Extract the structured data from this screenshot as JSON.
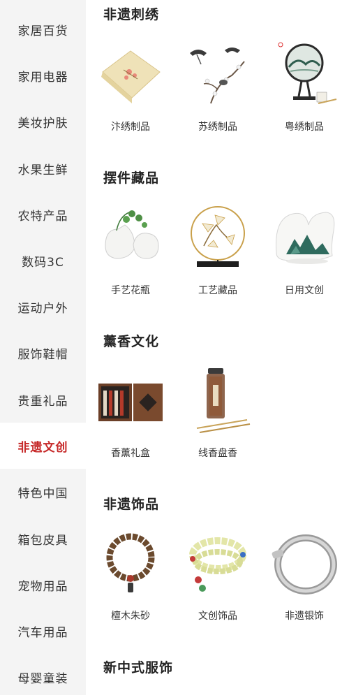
{
  "sidebar": {
    "items": [
      {
        "label": "家居百货"
      },
      {
        "label": "家用电器"
      },
      {
        "label": "美妆护肤"
      },
      {
        "label": "水果生鲜"
      },
      {
        "label": "农特产品"
      },
      {
        "label": "数码3C"
      },
      {
        "label": "运动户外"
      },
      {
        "label": "服饰鞋帽"
      },
      {
        "label": "贵重礼品"
      },
      {
        "label": "非遗文创",
        "active": true
      },
      {
        "label": "特色中国"
      },
      {
        "label": "箱包皮具"
      },
      {
        "label": "宠物用品"
      },
      {
        "label": "汽车用品"
      },
      {
        "label": "母婴童装"
      }
    ],
    "active_color": "#c62828"
  },
  "sections": [
    {
      "title": "非遗刺绣",
      "items": [
        {
          "label": "汴绣制品",
          "icon": "embroidered-cloth-icon"
        },
        {
          "label": "苏绣制品",
          "icon": "crane-plum-embroidery-icon"
        },
        {
          "label": "粤绣制品",
          "icon": "round-screen-embroidery-icon"
        }
      ]
    },
    {
      "title": "摆件藏品",
      "items": [
        {
          "label": "手艺花瓶",
          "icon": "ceramic-vase-icon"
        },
        {
          "label": "工艺藏品",
          "icon": "ginkgo-ornament-icon"
        },
        {
          "label": "日用文创",
          "icon": "landscape-ornament-icon"
        }
      ]
    },
    {
      "title": "薰香文化",
      "items": [
        {
          "label": "香薰礼盒",
          "icon": "incense-gift-box-icon"
        },
        {
          "label": "线香盘香",
          "icon": "incense-stick-jar-icon"
        }
      ]
    },
    {
      "title": "非遗饰品",
      "items": [
        {
          "label": "檀木朱砂",
          "icon": "sandalwood-bracelet-icon"
        },
        {
          "label": "文创饰品",
          "icon": "jade-bead-bracelet-icon"
        },
        {
          "label": "非遗银饰",
          "icon": "silver-bangle-icon"
        }
      ]
    },
    {
      "title": "新中式服饰",
      "items": []
    }
  ]
}
